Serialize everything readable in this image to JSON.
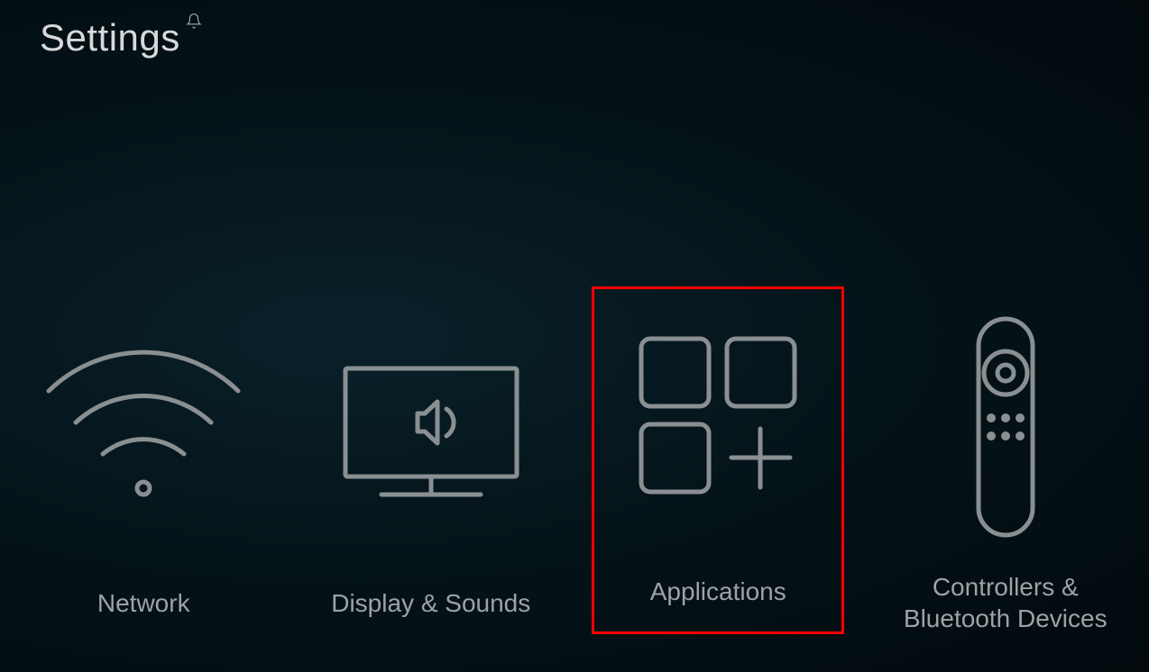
{
  "header": {
    "title": "Settings"
  },
  "tiles": {
    "network": {
      "label": "Network"
    },
    "display_sounds": {
      "label": "Display & Sounds"
    },
    "applications": {
      "label": "Applications"
    },
    "controllers": {
      "label": "Controllers & Bluetooth Devices"
    }
  },
  "highlight": "applications"
}
